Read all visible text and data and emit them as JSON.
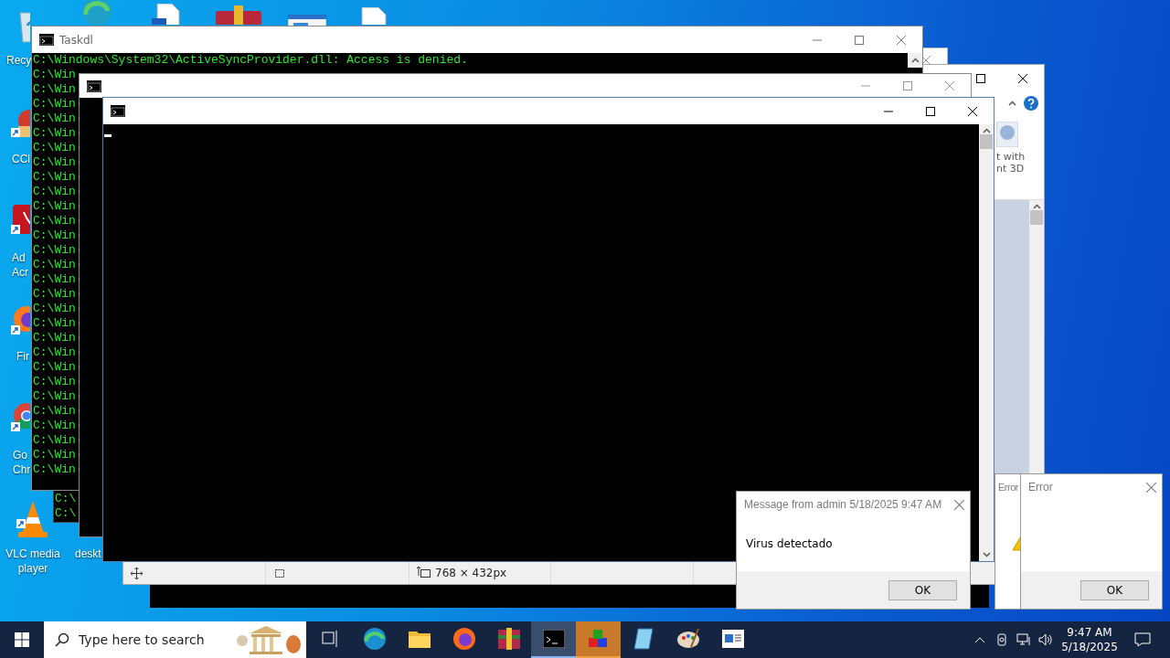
{
  "desktop": {
    "icons": [
      {
        "kind": "recycle-bin",
        "lines": [
          "Recy"
        ]
      },
      {
        "kind": "cleaner",
        "lines": [
          "CCl"
        ]
      },
      {
        "kind": "pdf",
        "lines": [
          "Ad",
          "Acr"
        ]
      },
      {
        "kind": "firefox",
        "lines": [
          "Fir"
        ]
      },
      {
        "kind": "chrome",
        "lines": [
          "Go",
          "Chr"
        ]
      },
      {
        "kind": "cone",
        "lines": [
          "VLC media",
          "player"
        ]
      },
      {
        "lines": [
          "deskt"
        ]
      }
    ],
    "top_icons": [
      {
        "kind": "edge"
      },
      {
        "kind": "document"
      },
      {
        "kind": "archive"
      },
      {
        "kind": "window"
      },
      {
        "kind": "file"
      }
    ]
  },
  "paint_window": {
    "ribbon_button": [
      "t with",
      "nt 3D"
    ],
    "status_size": "768 × 432px"
  },
  "console_behind": {
    "lines": [
      "C:\\",
      "C:\\"
    ]
  },
  "taskdl": {
    "title": "Taskdl",
    "lines": [
      "C:\\Windows\\System32\\ActiveSyncProvider.dll: Access is denied.",
      "C:\\Win",
      "C:\\Win",
      "C:\\Win",
      "C:\\Win",
      "C:\\Win",
      "C:\\Win",
      "C:\\Win",
      "C:\\Win",
      "C:\\Win",
      "C:\\Win",
      "C:\\Win",
      "C:\\Win",
      "C:\\Win",
      "C:\\Win",
      "C:\\Win",
      "C:\\Win",
      "C:\\Win",
      "C:\\Win",
      "C:\\Win",
      "C:\\Win",
      "C:\\Win",
      "C:\\Win",
      "C:\\Win",
      "C:\\Win",
      "C:\\Win",
      "C:\\Win",
      "C:\\Win",
      "C:\\Win"
    ]
  },
  "message": {
    "title": "Message from admin 5/18/2025 9:47 AM",
    "text": "Virus detectado",
    "button": "OK"
  },
  "errors": [
    {
      "title": "Error"
    },
    {
      "title": "Error",
      "button": "OK"
    }
  ],
  "taskbar": {
    "search": {
      "placeholder": "Type here to search"
    },
    "apps": [
      {
        "kind": "task-view",
        "active": false,
        "flashing": false
      },
      {
        "kind": "edge",
        "active": false,
        "flashing": false
      },
      {
        "kind": "folder",
        "active": false,
        "flashing": false
      },
      {
        "kind": "firefox",
        "active": false,
        "flashing": false
      },
      {
        "kind": "archive",
        "active": false,
        "flashing": false
      },
      {
        "kind": "terminal",
        "active": true,
        "flashing": false
      },
      {
        "kind": "blocks",
        "active": false,
        "flashing": true
      },
      {
        "kind": "notebook",
        "active": false,
        "flashing": false
      },
      {
        "kind": "palette",
        "active": false,
        "flashing": false
      },
      {
        "kind": "window",
        "active": false,
        "flashing": false
      }
    ],
    "time": "9:47 AM",
    "date": "5/18/2025"
  }
}
